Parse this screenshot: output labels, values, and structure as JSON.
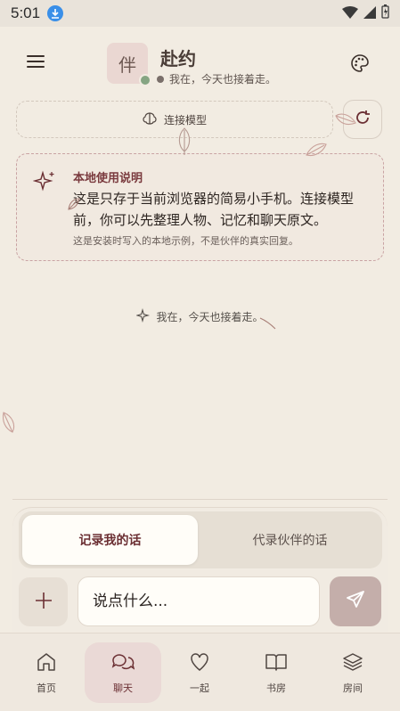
{
  "status_bar": {
    "time": "5:01"
  },
  "header": {
    "avatar_char": "伴",
    "name": "赴约",
    "status": "我在，今天也接着走。"
  },
  "connect": {
    "label": "连接模型"
  },
  "notice": {
    "title": "本地使用说明",
    "body": "这是只存于当前浏览器的简易小手机。连接模型前，你可以先整理人物、记忆和聊天原文。",
    "footnote": "这是安装时写入的本地示例，不是伙伴的真实回复。"
  },
  "chat": {
    "center_line": "我在，今天也接着走。"
  },
  "composer": {
    "tab_active": "记录我的话",
    "tab_inactive": "代录伙伴的话",
    "placeholder": "说点什么..."
  },
  "nav": {
    "items": [
      {
        "label": "首页",
        "icon": "home-icon"
      },
      {
        "label": "聊天",
        "icon": "chat-icon"
      },
      {
        "label": "一起",
        "icon": "heart-icon"
      },
      {
        "label": "书房",
        "icon": "book-icon"
      },
      {
        "label": "房间",
        "icon": "layers-icon"
      }
    ],
    "active_index": 1
  },
  "colors": {
    "background": "#f2ece2",
    "accent": "#6b2f33",
    "send_button": "#c4aeaa",
    "online_dot": "#86a583"
  }
}
